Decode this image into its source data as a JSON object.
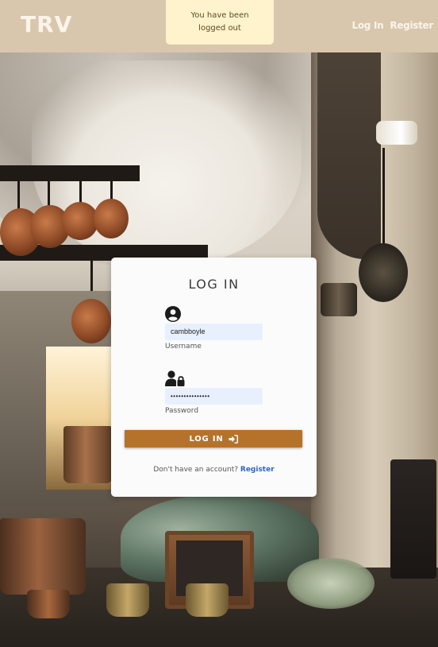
{
  "header": {
    "brand": "TRV",
    "nav": {
      "login": "Log In",
      "register": "Register"
    }
  },
  "flash": {
    "message": "You have been logged out"
  },
  "login_form": {
    "title": "LOG IN",
    "username": {
      "value": "cambboyle",
      "label": "Username",
      "icon": "user-circle-icon"
    },
    "password": {
      "value": "•••••••••••••••",
      "label": "Password",
      "icon": "user-lock-icon"
    },
    "submit_label": "LOG IN",
    "submit_icon": "sign-in-icon",
    "register_prompt": "Don't have an account?",
    "register_link": "Register"
  },
  "colors": {
    "header_bg": "#d8c7ad",
    "flash_bg": "#fff3cd",
    "button_bg": "#b5722a",
    "link": "#2f64c8",
    "input_bg": "#e8f0fe"
  }
}
